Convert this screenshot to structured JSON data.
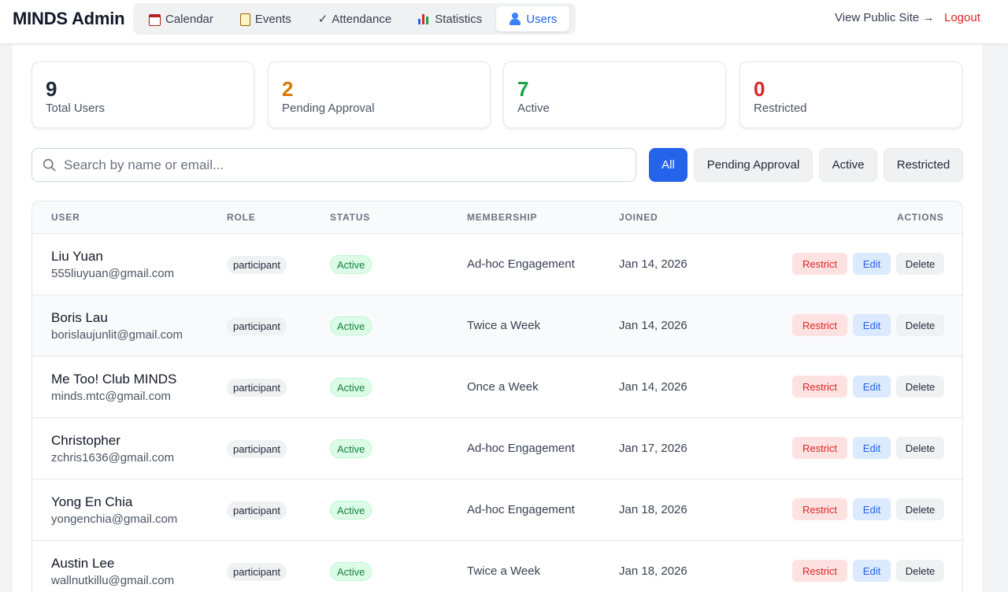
{
  "header": {
    "brand": "MINDS Admin",
    "nav": [
      {
        "label": "Calendar",
        "icon": "calendar-icon"
      },
      {
        "label": "Events",
        "icon": "clipboard-icon"
      },
      {
        "label": "Attendance",
        "icon": "check-icon"
      },
      {
        "label": "Statistics",
        "icon": "bar-chart-icon"
      },
      {
        "label": "Users",
        "icon": "user-icon",
        "active": true
      }
    ],
    "view_public": "View Public Site →",
    "logout": "Logout"
  },
  "stats": [
    {
      "value": "9",
      "label": "Total Users",
      "color": "#1f2937"
    },
    {
      "value": "2",
      "label": "Pending Approval",
      "color": "#d97706"
    },
    {
      "value": "7",
      "label": "Active",
      "color": "#16a34a"
    },
    {
      "value": "0",
      "label": "Restricted",
      "color": "#dc2626"
    }
  ],
  "search": {
    "placeholder": "Search by name or email...",
    "value": ""
  },
  "filters": [
    {
      "label": "All",
      "active": true
    },
    {
      "label": "Pending Approval",
      "active": false
    },
    {
      "label": "Active",
      "active": false
    },
    {
      "label": "Restricted",
      "active": false
    }
  ],
  "table": {
    "headers": {
      "user": "USER",
      "role": "ROLE",
      "status": "STATUS",
      "membership": "MEMBERSHIP",
      "joined": "JOINED",
      "actions": "ACTIONS"
    },
    "action_labels": {
      "restrict": "Restrict",
      "edit": "Edit",
      "delete": "Delete"
    },
    "rows": [
      {
        "name": "Liu Yuan",
        "email": "555liuyuan@gmail.com",
        "role": "participant",
        "status": "Active",
        "membership": "Ad-hoc Engagement",
        "joined": "Jan 14, 2026"
      },
      {
        "name": "Boris Lau",
        "email": "borislaujunlit@gmail.com",
        "role": "participant",
        "status": "Active",
        "membership": "Twice a Week",
        "joined": "Jan 14, 2026"
      },
      {
        "name": "Me Too! Club MINDS",
        "email": "minds.mtc@gmail.com",
        "role": "participant",
        "status": "Active",
        "membership": "Once a Week",
        "joined": "Jan 14, 2026"
      },
      {
        "name": "Christopher",
        "email": "zchris1636@gmail.com",
        "role": "participant",
        "status": "Active",
        "membership": "Ad-hoc Engagement",
        "joined": "Jan 17, 2026"
      },
      {
        "name": "Yong En Chia",
        "email": "yongenchia@gmail.com",
        "role": "participant",
        "status": "Active",
        "membership": "Ad-hoc Engagement",
        "joined": "Jan 18, 2026"
      },
      {
        "name": "Austin Lee",
        "email": "wallnutkillu@gmail.com",
        "role": "participant",
        "status": "Active",
        "membership": "Twice a Week",
        "joined": "Jan 18, 2026"
      }
    ]
  }
}
